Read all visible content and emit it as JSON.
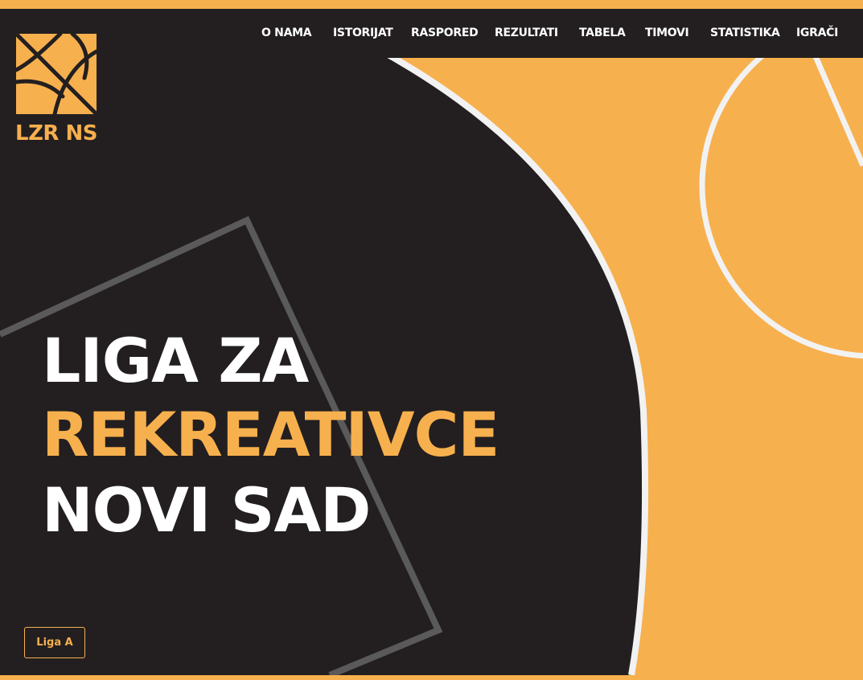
{
  "colors": {
    "accent": "#f7b04e",
    "dark": "#231f20",
    "white": "#ffffff",
    "gray": "#5a5a5a"
  },
  "nav": {
    "items": [
      {
        "label": "O NAMA"
      },
      {
        "label": "ISTORIJAT"
      },
      {
        "label": "RASPORED"
      },
      {
        "label": "REZULTATI"
      },
      {
        "label": "TABELA"
      },
      {
        "label": "TIMOVI"
      },
      {
        "label": "STATISTIKA"
      },
      {
        "label": "IGRAČI"
      }
    ]
  },
  "logo": {
    "text": "LZR NS",
    "icon": "basketball-icon"
  },
  "hero": {
    "line1": "LIGA ZA",
    "line2": "REKREATIVCE",
    "line3": "NOVI SAD"
  },
  "buttons": {
    "liga": "Liga A"
  }
}
